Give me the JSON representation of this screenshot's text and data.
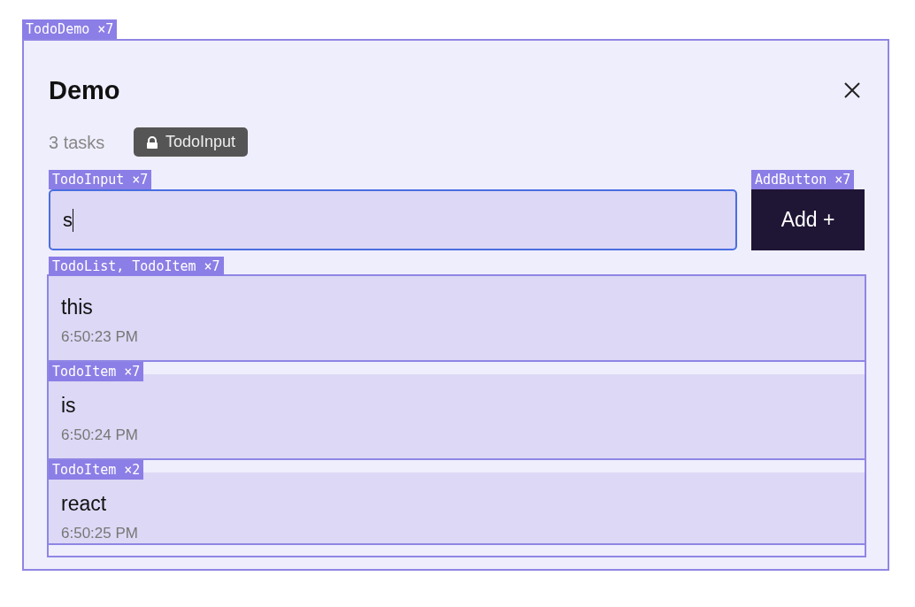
{
  "demo": {
    "highlight": "TodoDemo ×7",
    "title": "Demo",
    "task_count": "3 tasks"
  },
  "tooltip": {
    "label": "TodoInput"
  },
  "input": {
    "value": "s",
    "highlight": "TodoInput ×7",
    "focused": true
  },
  "add_button": {
    "label": "Add +",
    "highlight": "AddButton ×7"
  },
  "todos": [
    {
      "text": "this",
      "time": "6:50:23 PM",
      "highlight": "TodoList, TodoItem ×7"
    },
    {
      "text": "is",
      "time": "6:50:24 PM",
      "highlight": "TodoItem ×7"
    },
    {
      "text": "react",
      "time": "6:50:25 PM",
      "highlight": "TodoItem ×2"
    }
  ]
}
